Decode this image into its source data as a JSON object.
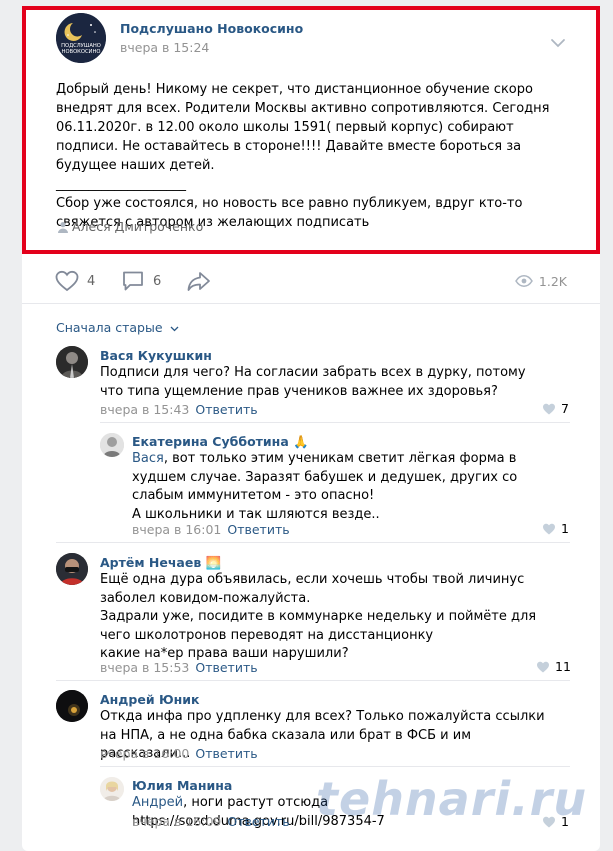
{
  "post": {
    "group_name": "Подслушано Новокосино",
    "avatar_text": "Подслушано Новокосино",
    "time": "вчера в 15:24",
    "text": "Добрый день! Никому не секрет, что дистанционное обучение скоро внедрят для всех. Родители Москвы активно сопротивляются. Сегодня 06.11.2020г. в 12.00 около школы 1591( первый корпус) собирают подписи. Не оставайтесь в стороне!!!! Давайте вместе бороться за будущее наших детей.\n____________________\nСбор уже состоялся, но новость все равно публикуем, вдруг кто-то свяжется с автором из желающих подписать",
    "signer": "Алеся Дмитроченко"
  },
  "actions": {
    "likes": "4",
    "comments": "6",
    "views": "1.2K"
  },
  "comments_sort": "Сначала старые",
  "comments": [
    {
      "author": "Вася Кукушкин",
      "text": "Подписи для чего? На согласии забрать всех в дурку, потому что типа ущемление прав учеников важнее их здоровья?",
      "time": "вчера в 15:43",
      "reply": "Ответить",
      "likes": "7"
    },
    {
      "author": "Екатерина Субботина 🙏",
      "addressee": "Вася",
      "text": ", вот только этим ученикам светит лёгкая форма в худшем случае. Заразят бабушек и дедушек, других со слабым иммунитетом - это опасно!\nА школьники и так шляются везде..",
      "time": "вчера в 16:01",
      "reply": "Ответить",
      "likes": "1"
    },
    {
      "author": "Артём Нечаев 🌅",
      "text": "Ещё одна дура объявилась, если хочешь чтобы твой личинус заболел ковидом-пожалуйста.\nЗадрали уже, посидите в коммунарке недельку и поймёте для чего школотронов переводят на дисстанционку\nкакие на*ер права ваши нарушили?",
      "time": "вчера в 15:53",
      "reply": "Ответить",
      "likes": "11"
    },
    {
      "author": "Андрей Юник",
      "text": "Откда инфа про удпленку для всех? Только пожалуйста ссылки на НПА, а не одна бабка сказала или брат в ФСБ и им рассказали...",
      "time": "вчера в 16:00",
      "reply": "Ответить",
      "likes": ""
    },
    {
      "author": "Юлия Манина",
      "addressee": "Андрей",
      "text": ", ноги растут отсюда https://sozd.duma.gov.ru/bill/987354-7",
      "time": "вчера в 16:09",
      "reply": "Ответить",
      "likes": "1"
    }
  ],
  "watermark": "tehnari.ru",
  "colors": {
    "link": "#2a5885",
    "highlight": "#e3001b",
    "muted": "#939393"
  }
}
